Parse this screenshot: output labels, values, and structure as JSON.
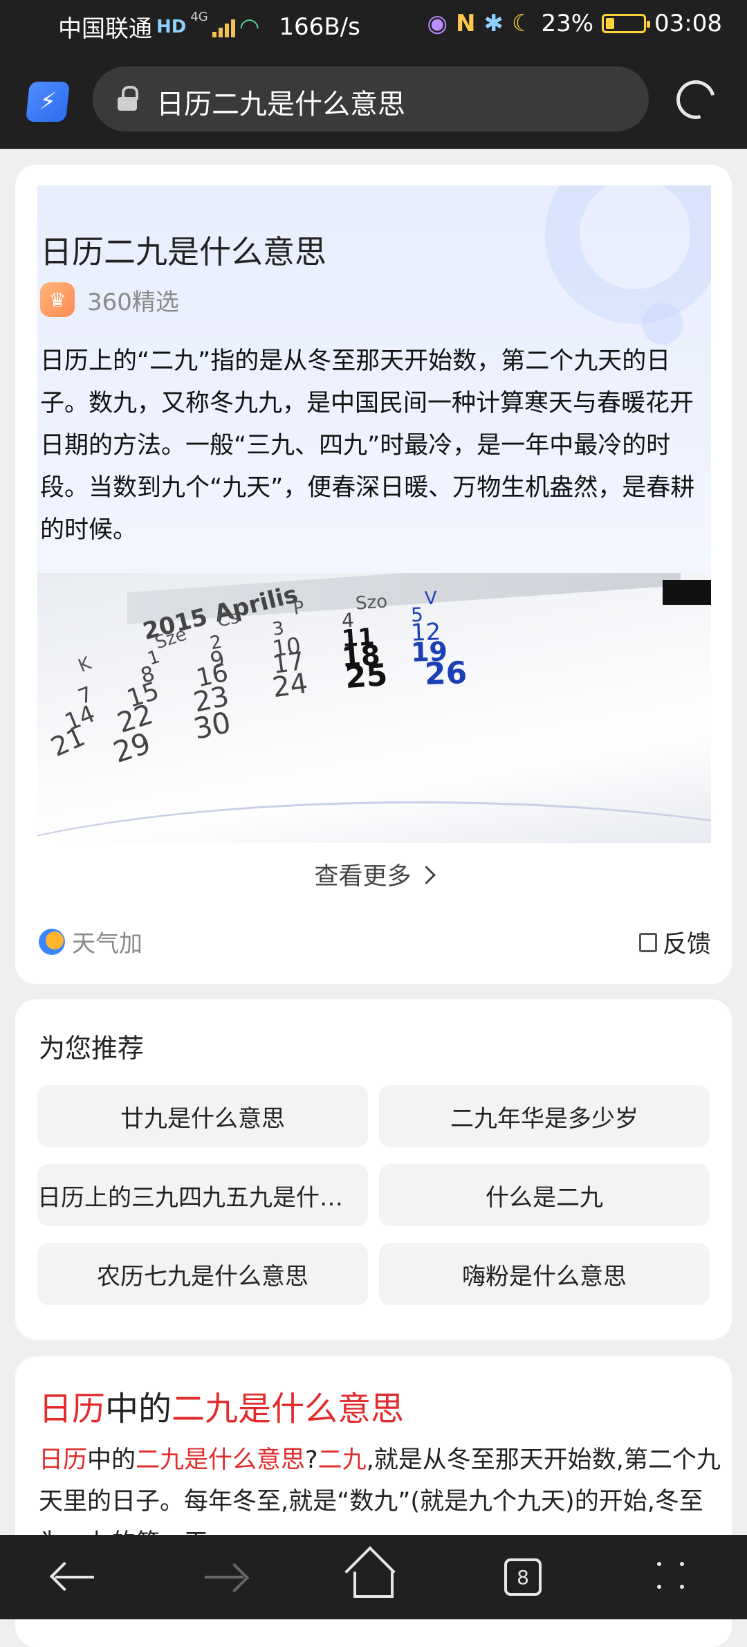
{
  "status_bar": {
    "carrier": "中国联通",
    "hd": "HD",
    "net": "4G",
    "speed": "166B/s",
    "battery": "23%",
    "battery_level": 0.23,
    "time": "03:08"
  },
  "toolbar": {
    "url_text": "日历二九是什么意思"
  },
  "answer_card": {
    "title": "日历二九是什么意思",
    "source": "360精选",
    "body": "日历上的“二九”指的是从冬至那天开始数，第二个九天的日子。数九，又称冬九九，是中国民间一种计算寒天与春暖花开日期的方法。一般“三九、四九”时最冷，是一年中最冷的时段。当数到九个“九天”，便春深日暖、万物生机盎然，是春耕的时候。",
    "image_text": {
      "header": "2015 Aprilis",
      "weekdays": [
        "K",
        "Sze",
        "Cs",
        "P",
        "Szo",
        "V"
      ],
      "dates": [
        "1",
        "2",
        "3",
        "4",
        "5",
        "7",
        "8",
        "9",
        "10",
        "11",
        "12",
        "14",
        "15",
        "16",
        "17",
        "18",
        "19",
        "21",
        "22",
        "23",
        "24",
        "25",
        "26",
        "29",
        "30"
      ]
    },
    "more_label": "查看更多",
    "brand_label": "天气加",
    "feedback_label": "反馈"
  },
  "recommend": {
    "title": "为您推荐",
    "items": [
      "廿九是什么意思",
      "二九年华是多少岁",
      "日历上的三九四九五九是什么意思",
      "什么是二九",
      "农历七九是什么意思",
      "嗨粉是什么意思"
    ]
  },
  "result": {
    "title_parts": [
      "日历",
      "中的",
      "二九是什么意思"
    ],
    "body_parts": [
      "日历",
      "中的",
      "二九是什么意思",
      "?",
      "二九",
      ",就是从冬至那天开始数,第二个九天里的日子。每年冬至,就是“数九”(就是九个九天)的开始,冬至为一九的第一天,..."
    ]
  },
  "nav": {
    "tab_count": "8"
  },
  "colors": {
    "bar_bg": "#202020",
    "highlight_red": "#e22b2b",
    "accent_blue": "#3b86ff"
  }
}
